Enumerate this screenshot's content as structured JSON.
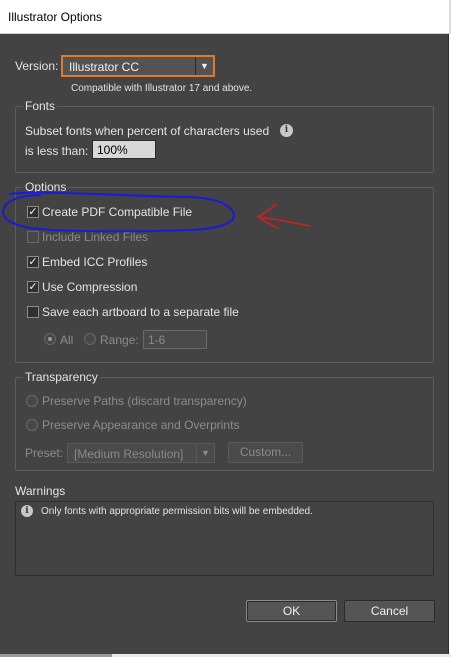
{
  "window": {
    "title": "Illustrator Options"
  },
  "version": {
    "label": "Version:",
    "selected": "Illustrator CC",
    "note": "Compatible with Illustrator 17 and above."
  },
  "fonts": {
    "legend": "Fonts",
    "subset_line1": "Subset fonts when percent of characters used",
    "subset_line2": "is less than:",
    "percent_value": "100%",
    "info_glyph": "i"
  },
  "options": {
    "legend": "Options",
    "create_pdf": {
      "label": "Create PDF Compatible File",
      "checked": true
    },
    "include_linked": {
      "label": "Include Linked Files",
      "checked": false,
      "enabled": false
    },
    "embed_icc": {
      "label": "Embed ICC Profiles",
      "checked": true
    },
    "use_compression": {
      "label": "Use Compression",
      "checked": true
    },
    "save_artboards": {
      "label": "Save each artboard to a separate file",
      "checked": false
    },
    "all_label": "All",
    "range_label": "Range:",
    "range_value": "1-6"
  },
  "transparency": {
    "legend": "Transparency",
    "preserve_paths": "Preserve Paths (discard transparency)",
    "preserve_appearance": "Preserve Appearance and Overprints",
    "preset_label": "Preset:",
    "preset_value": "[Medium Resolution]",
    "custom_label": "Custom..."
  },
  "warnings": {
    "legend": "Warnings",
    "message": "Only fonts with appropriate permission bits will be embedded."
  },
  "buttons": {
    "ok": "OK",
    "cancel": "Cancel"
  },
  "glyphs": {
    "check": "✓",
    "dropdown_arrow": "▼"
  },
  "colors": {
    "dialog_bg": "#434343",
    "focus_ring": "#e07a2a",
    "annotation_circle": "#1a1adc",
    "annotation_arrow": "#d21f1f"
  }
}
